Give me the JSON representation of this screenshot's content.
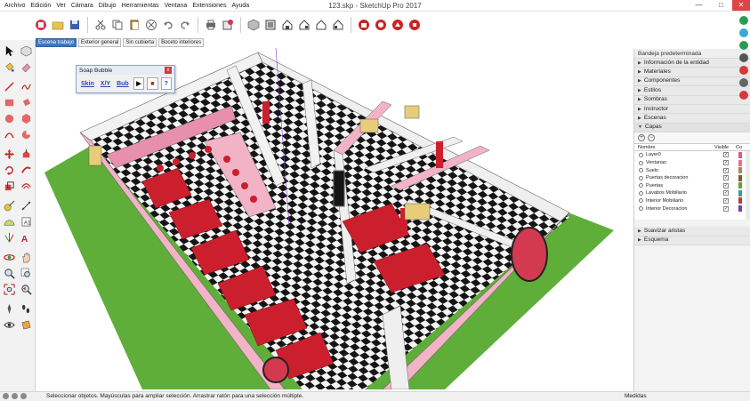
{
  "window": {
    "title": "123.skp - SketchUp Pro 2017",
    "controls": {
      "minimize": "—",
      "maximize": "□",
      "close": "✕"
    }
  },
  "menu": [
    "Archivo",
    "Edición",
    "Ver",
    "Cámara",
    "Dibujo",
    "Herramientas",
    "Ventana",
    "Extensiones",
    "Ayuda"
  ],
  "scene_tabs": [
    {
      "label": "Escena trabajo",
      "active": true
    },
    {
      "label": "Exterior general",
      "active": false
    },
    {
      "label": "Sin cubierta",
      "active": false
    },
    {
      "label": "Boceto interiores",
      "active": false
    }
  ],
  "soap_bubble": {
    "title": "Soap Bubble",
    "close": "x",
    "buttons": [
      "Skin",
      "X/Y",
      "Bub",
      "▶",
      "■",
      "?"
    ]
  },
  "tray": {
    "title": "Bandeja predeterminada",
    "sections_top": [
      "Información de la entidad",
      "Materiales",
      "Componentes",
      "Estilos",
      "Sombras",
      "Instructor",
      "Escenas"
    ],
    "layers_section": "Capas",
    "layers_tools": {
      "add": "+",
      "remove": "−"
    },
    "layers_columns": {
      "name": "Nombre",
      "visible": "Visible",
      "color": "Co"
    },
    "layers": [
      {
        "name": "Layer0",
        "color": "#e05a87"
      },
      {
        "name": "Ventanas",
        "color": "#e0719a"
      },
      {
        "name": "Suelo",
        "color": "#a58b4a"
      },
      {
        "name": "Puertas decoracion",
        "color": "#7a5c34"
      },
      {
        "name": "Puertas",
        "color": "#6aa03a"
      },
      {
        "name": "Lavabos Mobiliario",
        "color": "#3c9c9c"
      },
      {
        "name": "Interior Mobiliario",
        "color": "#c03a2c"
      },
      {
        "name": "Interior Decoracion",
        "color": "#7a3fb0"
      }
    ],
    "sections_bottom": [
      "Suavizar aristas",
      "Esquema"
    ]
  },
  "status": {
    "message": "Seleccionar objetos. Mayúsculas para ampliar selección. Arrastrar ratón para una selección múltiple.",
    "measurements_label": "Medidas"
  },
  "colors": {
    "accent": "#3b78c2",
    "ground": "#5fae3a",
    "wall_pink": "#f2b3c6",
    "booth_red": "#cc1f2d"
  }
}
